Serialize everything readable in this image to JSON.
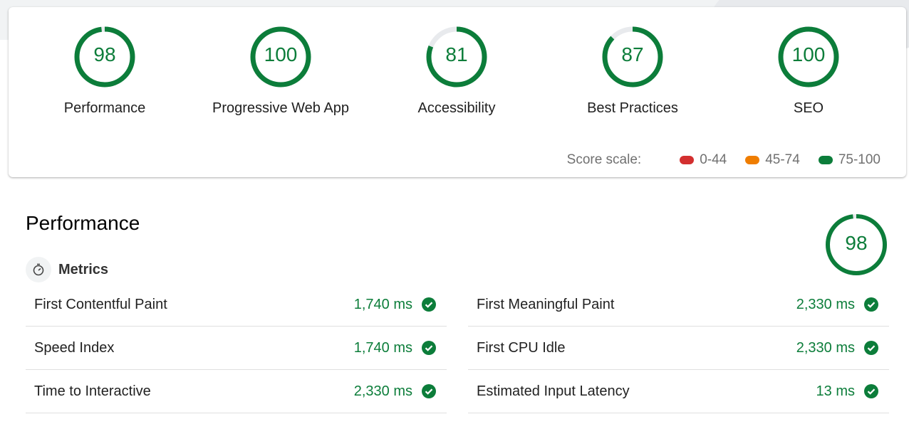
{
  "colors": {
    "pass": "#0c7d3a",
    "fail": "#d32f2f",
    "average": "#ef7d00",
    "track": "#e8eaed"
  },
  "categories": [
    {
      "score": "98",
      "label": "Performance",
      "fraction": 0.98
    },
    {
      "score": "100",
      "label": "Progressive Web App",
      "fraction": 1.0
    },
    {
      "score": "81",
      "label": "Accessibility",
      "fraction": 0.81
    },
    {
      "score": "87",
      "label": "Best Practices",
      "fraction": 0.87
    },
    {
      "score": "100",
      "label": "SEO",
      "fraction": 1.0
    }
  ],
  "score_scale": {
    "title": "Score scale:",
    "ranges": [
      {
        "label": "0-44",
        "color": "#d32f2f"
      },
      {
        "label": "45-74",
        "color": "#ef7d00"
      },
      {
        "label": "75-100",
        "color": "#0c7d3a"
      }
    ]
  },
  "performance": {
    "title": "Performance",
    "score": "98",
    "fraction": 0.98,
    "metrics_label": "Metrics",
    "metrics_left": [
      {
        "name": "First Contentful Paint",
        "value": "1,740 ms"
      },
      {
        "name": "Speed Index",
        "value": "1,740 ms"
      },
      {
        "name": "Time to Interactive",
        "value": "2,330 ms"
      }
    ],
    "metrics_right": [
      {
        "name": "First Meaningful Paint",
        "value": "2,330 ms"
      },
      {
        "name": "First CPU Idle",
        "value": "2,330 ms"
      },
      {
        "name": "Estimated Input Latency",
        "value": "13 ms"
      }
    ]
  }
}
